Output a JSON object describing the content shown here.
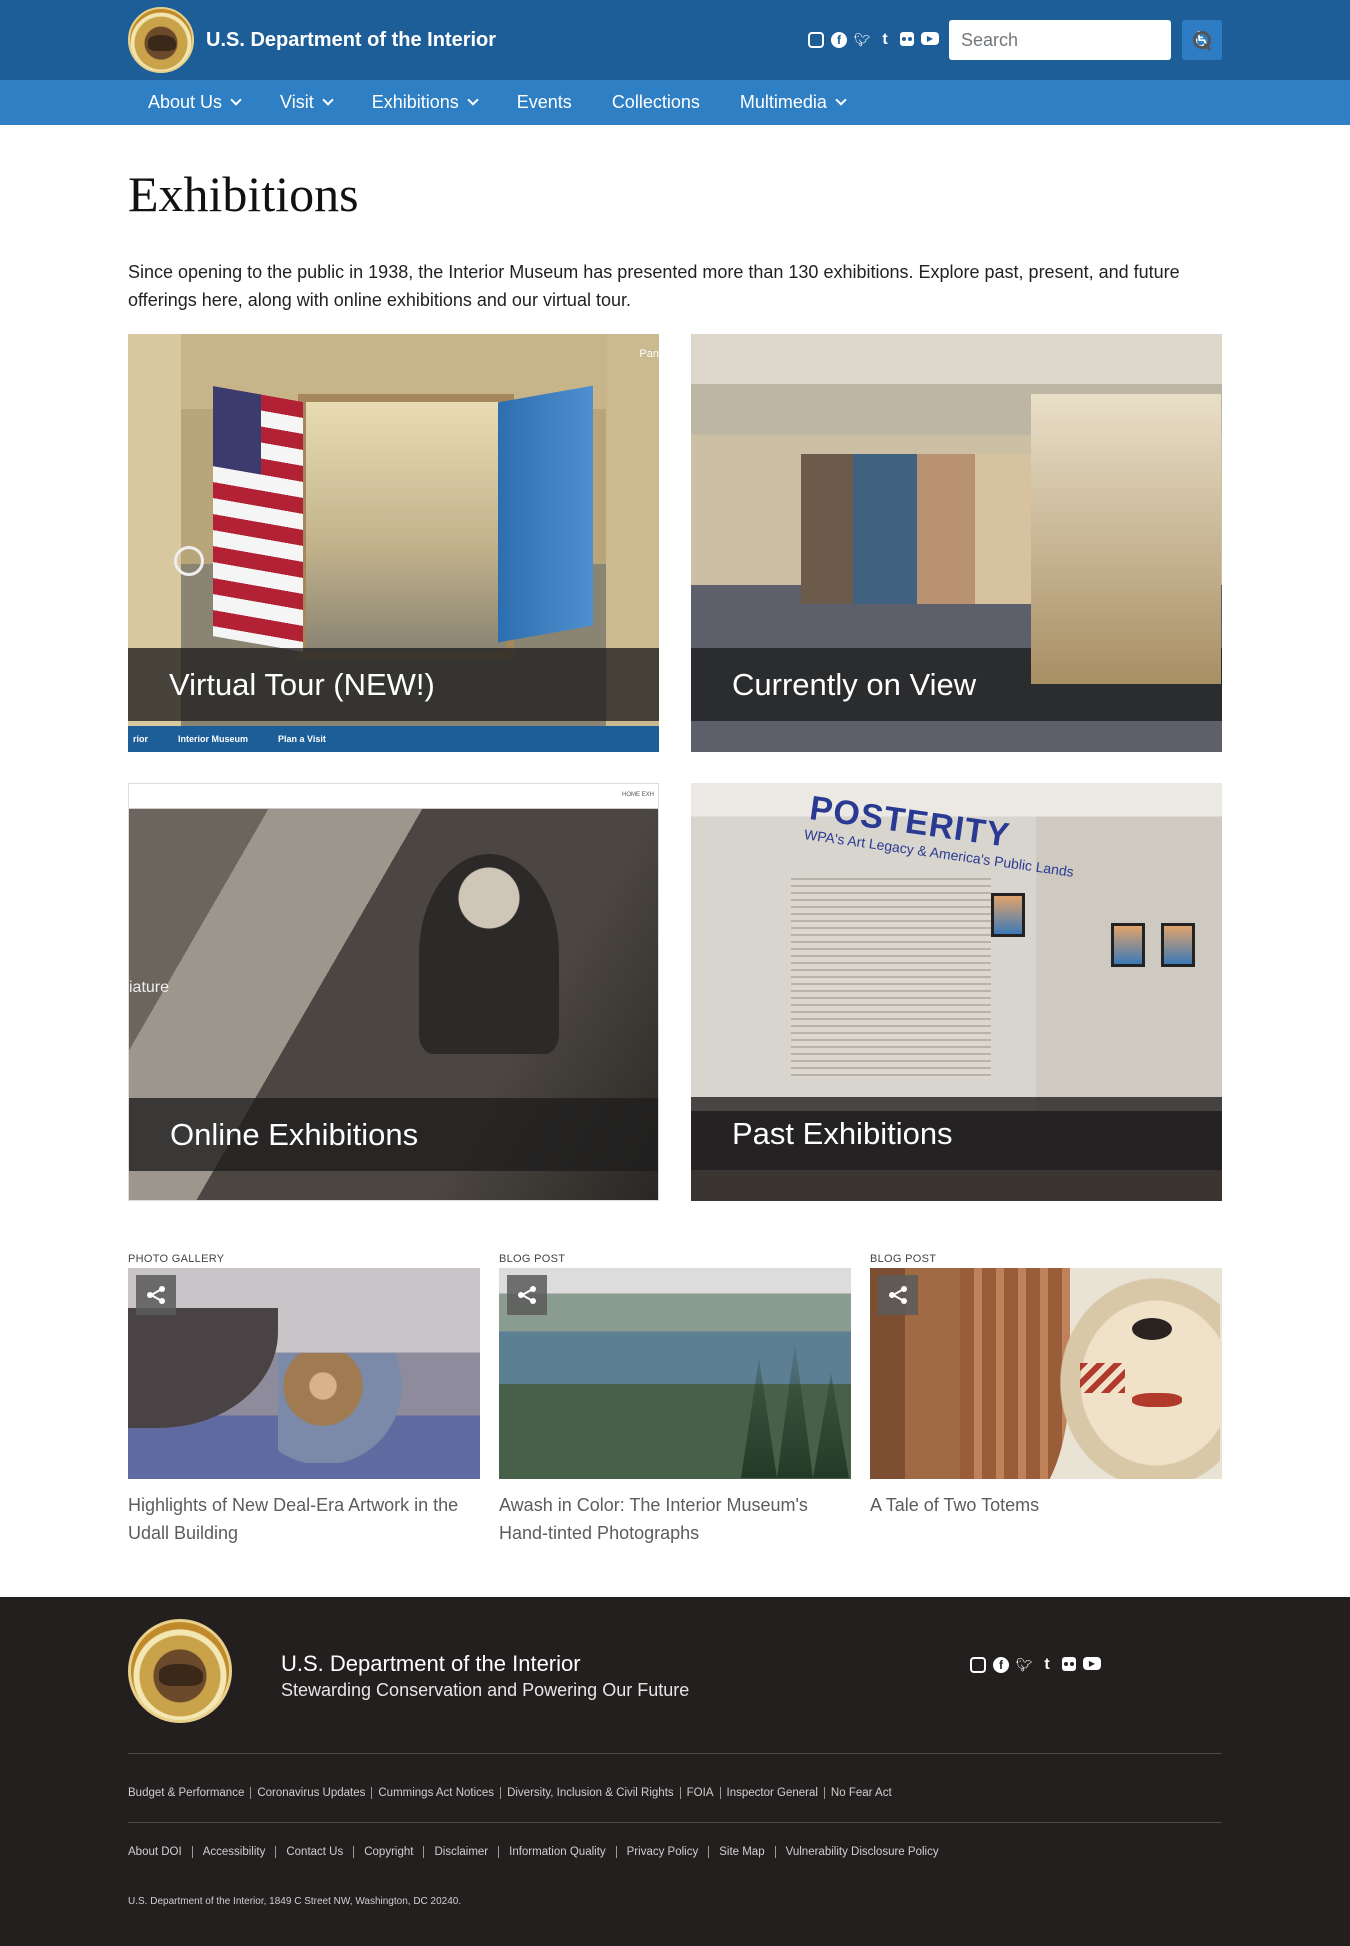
{
  "header": {
    "site_title": "U.S. Department of the Interior",
    "search_placeholder": "Search",
    "social_icons": [
      "instagram-icon",
      "facebook-icon",
      "twitter-icon",
      "tumblr-icon",
      "flickr-icon",
      "youtube-icon"
    ]
  },
  "nav": {
    "items": [
      {
        "label": "About Us",
        "dropdown": true
      },
      {
        "label": "Visit",
        "dropdown": true
      },
      {
        "label": "Exhibitions",
        "dropdown": true
      },
      {
        "label": "Events",
        "dropdown": false
      },
      {
        "label": "Collections",
        "dropdown": false
      },
      {
        "label": "Multimedia",
        "dropdown": true
      }
    ]
  },
  "main": {
    "title": "Exhibitions",
    "intro": "Since opening to the public in 1938, the Interior Museum has presented more than 130 exhibitions. Explore past, present, and future offerings here, along with online exhibitions and our virtual tour.",
    "tiles": [
      {
        "label": "Virtual Tour (NEW!)",
        "bar_items": [
          "rior",
          "Interior Museum",
          "Plan a Visit"
        ],
        "corner_text": "Pan"
      },
      {
        "label": "Currently on View"
      },
      {
        "label": "Online Exhibitions",
        "overlay_text": "iature",
        "header_links": "HOME   EXH"
      },
      {
        "label": "Past Exhibitions",
        "sign_title": "POSTERITY",
        "sign_sub": "WPA's Art Legacy & America's Public Lands"
      }
    ],
    "cards": [
      {
        "kicker": "PHOTO GALLERY",
        "title": "Highlights of New Deal-Era Artwork in the Udall Building"
      },
      {
        "kicker": "BLOG POST",
        "title": "Awash in Color: The Interior Museum's Hand-tinted Photographs"
      },
      {
        "kicker": "BLOG POST",
        "title": "A Tale of Two Totems"
      }
    ]
  },
  "footer": {
    "title": "U.S. Department of the Interior",
    "tagline": "Stewarding Conservation and Powering Our Future",
    "links_row1": [
      "Budget & Performance",
      "Coronavirus Updates",
      "Cummings Act Notices",
      "Diversity, Inclusion & Civil Rights",
      "FOIA",
      "Inspector General",
      "No Fear Act"
    ],
    "links_row2": [
      "About DOI",
      "Accessibility",
      "Contact Us",
      "Copyright",
      "Disclaimer",
      "Information Quality",
      "Privacy Policy",
      "Site Map",
      "Vulnerability Disclosure Policy"
    ],
    "address": "U.S. Department of the Interior, 1849 C Street NW, Washington, DC 20240."
  },
  "colors": {
    "header_bg": "#1d5e99",
    "nav_bg": "#2e7fc4",
    "footer_bg": "#231f1f"
  }
}
